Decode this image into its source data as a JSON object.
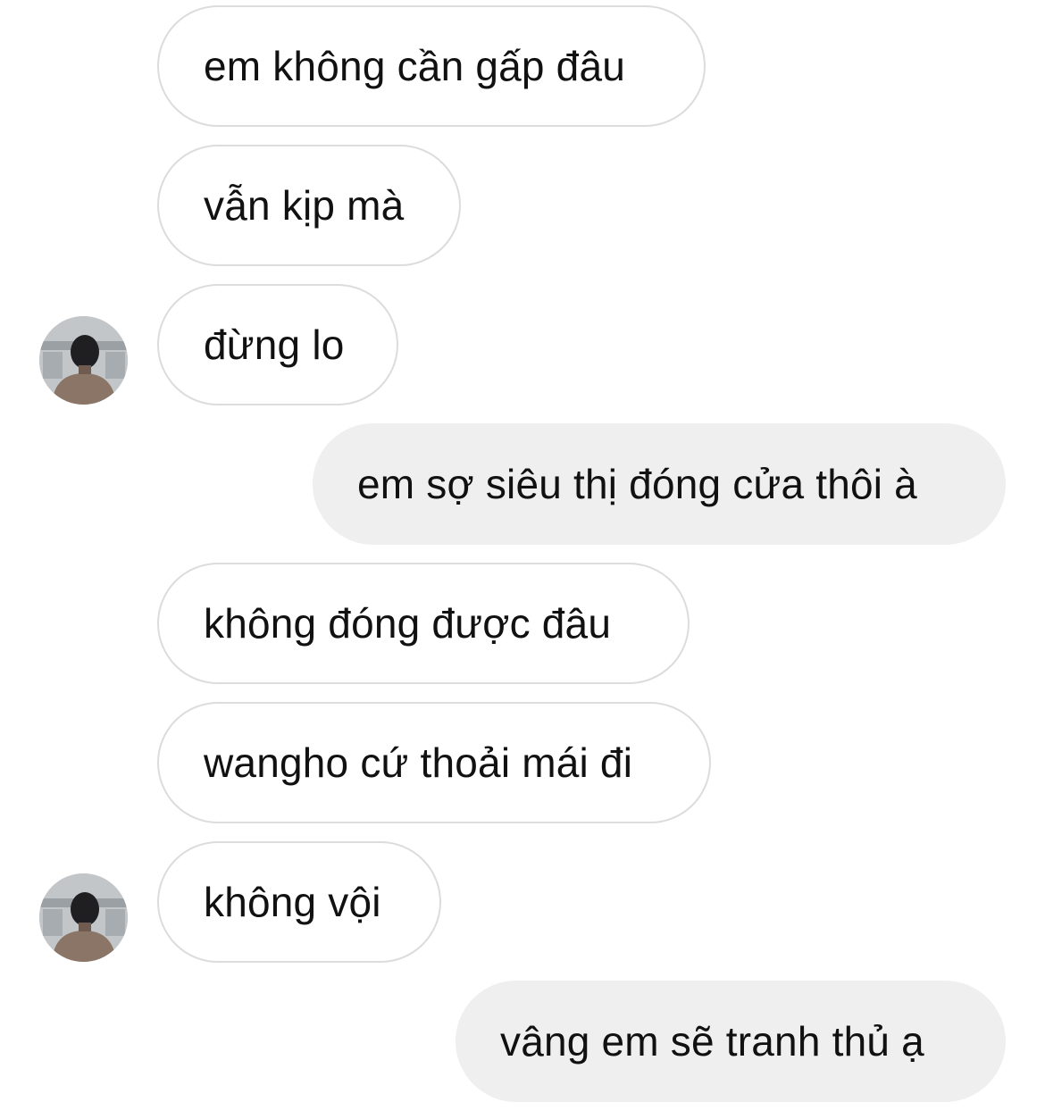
{
  "conversation": {
    "messages": [
      {
        "sender": "other",
        "text": "em không cần gấp đâu"
      },
      {
        "sender": "other",
        "text": "vẫn kịp mà"
      },
      {
        "sender": "other",
        "text": "đừng lo",
        "show_avatar": true
      },
      {
        "sender": "me",
        "text": "em sợ siêu thị đóng cửa thôi à"
      },
      {
        "sender": "other",
        "text": "không đóng được đâu"
      },
      {
        "sender": "other",
        "text": "wangho cứ thoải mái đi"
      },
      {
        "sender": "other",
        "text": "không vội",
        "show_avatar": true
      },
      {
        "sender": "me",
        "text": "vâng em sẽ tranh thủ ạ"
      }
    ]
  },
  "colors": {
    "incoming_border": "#dcdcdc",
    "incoming_bg": "#ffffff",
    "outgoing_bg": "#efefef",
    "text": "#111111"
  },
  "icons": {
    "avatar": "person-photo-avatar"
  }
}
